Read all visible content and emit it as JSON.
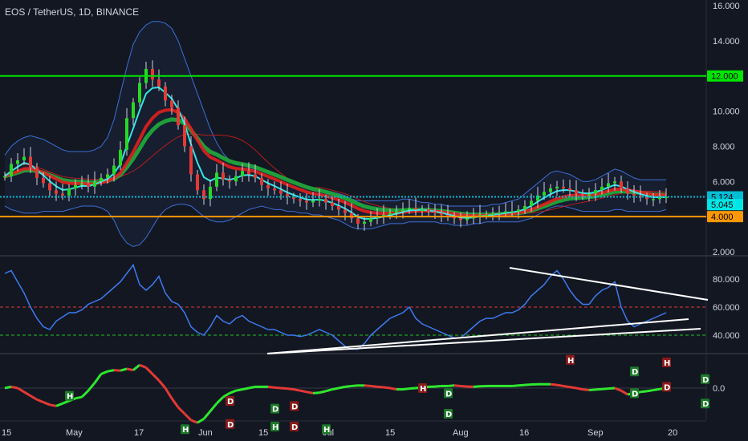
{
  "header": {
    "title": "EOS / TetherUS, 1D, BINANCE"
  },
  "colors": {
    "background": "#131722",
    "grid": "#2a2e39",
    "text": "#d1d4dc",
    "up": "#26d926",
    "down": "#e53935",
    "bb": "#3d6fd6",
    "ema_fast": "#32e6e6",
    "ema_slow": "#e01f1f",
    "ema_green": "#1f9e3a",
    "level_green": "#00e600",
    "level_orange": "#ff9800",
    "level_cyan": "#00bcd4",
    "rsi": "#3d7bf0",
    "rsi_upper": "#e53935",
    "rsi_lower": "#22c322",
    "trend": "#ffffff",
    "osc_up": "#2ee82e",
    "osc_down": "#e53935"
  },
  "chart_data": [
    {
      "type": "candlestick",
      "pair": "EOS / TetherUS",
      "interval": "1D",
      "exchange": "BINANCE",
      "ylim": [
        2,
        16
      ],
      "y_ticks": [
        "2.000",
        "4.000",
        "6.000",
        "8.000",
        "10.000",
        "12.000",
        "14.000",
        "16.000"
      ],
      "x_ticks": [
        "15",
        "May",
        "17",
        "Jun",
        "15",
        "Jul",
        "15",
        "Aug",
        "16",
        "Sep",
        "20"
      ],
      "price_labels": [
        {
          "label": "12.000",
          "value": 12.0,
          "color": "#00e600",
          "text_color": "#000000"
        },
        {
          "label": "5.124",
          "value": 5.124,
          "color": "#00bcd4",
          "text_color": "#000000"
        },
        {
          "label": "5.045",
          "value": 5.045,
          "color": "#00e6e6",
          "text_color": "#000000"
        },
        {
          "label": "4.000",
          "value": 4.0,
          "color": "#ff9800",
          "text_color": "#000000"
        }
      ],
      "horizontal_levels": [
        12.0,
        5.124,
        4.0
      ],
      "close": [
        6.3,
        7.0,
        7.2,
        7.4,
        6.8,
        6.2,
        5.9,
        5.5,
        5.3,
        5.2,
        5.6,
        5.8,
        5.9,
        5.7,
        6.0,
        6.2,
        6.4,
        6.9,
        7.8,
        9.6,
        10.5,
        11.6,
        12.4,
        11.8,
        11.4,
        10.6,
        10.2,
        9.2,
        8.0,
        6.4,
        5.5,
        5.0,
        5.7,
        6.5,
        6.1,
        6.0,
        6.3,
        6.6,
        6.4,
        6.2,
        5.8,
        5.6,
        5.5,
        5.3,
        5.1,
        5.0,
        4.9,
        4.8,
        4.9,
        5.0,
        4.8,
        4.6,
        4.4,
        4.2,
        3.9,
        3.6,
        3.7,
        3.9,
        4.0,
        4.1,
        4.2,
        4.3,
        4.4,
        4.5,
        4.4,
        4.4,
        4.3,
        4.2,
        4.1,
        4.0,
        3.9,
        3.8,
        3.9,
        4.0,
        4.1,
        4.1,
        4.2,
        4.2,
        4.3,
        4.3,
        4.4,
        4.6,
        4.9,
        5.2,
        5.4,
        5.6,
        5.7,
        5.6,
        5.5,
        5.3,
        5.2,
        5.3,
        5.5,
        5.7,
        5.9,
        6.0,
        5.6,
        5.3,
        5.2,
        5.1,
        5.0,
        5.0,
        5.1,
        5.124
      ],
      "bollinger_upper": [
        7.5,
        8.0,
        8.3,
        8.5,
        8.6,
        8.5,
        8.4,
        8.2,
        8.0,
        7.8,
        7.7,
        7.7,
        7.7,
        7.7,
        7.8,
        8.0,
        8.5,
        9.5,
        11.0,
        12.5,
        13.8,
        14.5,
        14.9,
        15.1,
        15.1,
        15.0,
        14.7,
        14.0,
        13.0,
        12.0,
        11.0,
        10.0,
        9.0,
        8.2,
        7.6,
        7.2,
        7.0,
        6.9,
        6.8,
        6.7,
        6.6,
        6.5,
        6.4,
        6.2,
        6.0,
        5.9,
        5.8,
        5.7,
        5.6,
        5.5,
        5.5,
        5.4,
        5.3,
        5.2,
        5.0,
        4.9,
        4.9,
        4.9,
        4.9,
        4.9,
        4.9,
        4.9,
        5.0,
        5.0,
        4.9,
        4.8,
        4.8,
        4.7,
        4.7,
        4.6,
        4.6,
        4.6,
        4.6,
        4.6,
        4.6,
        4.6,
        4.7,
        4.7,
        4.8,
        4.9,
        5.0,
        5.3,
        5.6,
        5.9,
        6.2,
        6.5,
        6.6,
        6.5,
        6.4,
        6.2,
        6.0,
        6.0,
        6.1,
        6.3,
        6.5,
        6.7,
        6.6,
        6.4,
        6.2,
        6.1,
        6.1,
        6.1,
        6.1,
        6.1
      ],
      "bollinger_lower": [
        4.6,
        4.4,
        4.3,
        4.2,
        4.2,
        4.2,
        4.3,
        4.3,
        4.3,
        4.3,
        4.4,
        4.5,
        4.6,
        4.6,
        4.6,
        4.5,
        4.3,
        3.8,
        3.0,
        2.5,
        2.3,
        2.4,
        2.8,
        3.4,
        4.0,
        4.4,
        4.6,
        4.7,
        4.7,
        4.6,
        4.3,
        4.0,
        3.8,
        3.7,
        3.7,
        3.8,
        4.0,
        4.2,
        4.4,
        4.5,
        4.6,
        4.5,
        4.4,
        4.4,
        4.3,
        4.3,
        4.2,
        4.2,
        4.1,
        4.1,
        4.0,
        3.9,
        3.8,
        3.6,
        3.4,
        3.3,
        3.3,
        3.3,
        3.4,
        3.5,
        3.6,
        3.6,
        3.6,
        3.7,
        3.7,
        3.7,
        3.7,
        3.7,
        3.6,
        3.6,
        3.5,
        3.5,
        3.5,
        3.6,
        3.6,
        3.7,
        3.7,
        3.7,
        3.7,
        3.7,
        3.7,
        3.8,
        3.9,
        4.1,
        4.3,
        4.5,
        4.6,
        4.6,
        4.5,
        4.4,
        4.3,
        4.3,
        4.3,
        4.3,
        4.3,
        4.4,
        4.4,
        4.3,
        4.3,
        4.3,
        4.3,
        4.3,
        4.3,
        4.4
      ]
    },
    {
      "type": "line",
      "indicator": "RSI",
      "ylim": [
        20,
        100
      ],
      "y_ticks": [
        "40.000",
        "60.000",
        "80.000"
      ],
      "bands": [
        60,
        40
      ],
      "values": [
        84,
        86,
        78,
        70,
        60,
        52,
        46,
        44,
        50,
        53,
        56,
        56,
        58,
        62,
        64,
        66,
        70,
        74,
        78,
        84,
        90,
        76,
        72,
        76,
        82,
        70,
        64,
        62,
        56,
        46,
        42,
        40,
        46,
        54,
        50,
        48,
        52,
        54,
        50,
        48,
        46,
        44,
        44,
        42,
        40,
        40,
        39,
        40,
        42,
        44,
        42,
        40,
        36,
        32,
        30,
        30,
        34,
        40,
        44,
        48,
        52,
        54,
        56,
        60,
        52,
        48,
        46,
        44,
        42,
        40,
        38,
        38,
        42,
        46,
        50,
        52,
        52,
        54,
        56,
        56,
        58,
        62,
        68,
        72,
        76,
        82,
        86,
        80,
        72,
        66,
        62,
        62,
        68,
        72,
        74,
        78,
        60,
        50,
        46,
        48,
        50,
        52,
        54,
        56
      ],
      "trendlines": [
        {
          "from": [
            87,
            88
          ],
          "to": [
            103,
            65
          ]
        },
        {
          "from": [
            47,
            30
          ],
          "to": [
            103,
            53
          ]
        },
        {
          "from": [
            47,
            30
          ],
          "to": [
            103,
            44
          ]
        }
      ]
    },
    {
      "type": "line",
      "indicator": "oscillator",
      "ylim": [
        -1.4,
        1.2
      ],
      "y_ticks": [
        "0.0"
      ],
      "values": [
        0.0,
        0.05,
        0.0,
        -0.15,
        -0.3,
        -0.45,
        -0.55,
        -0.65,
        -0.7,
        -0.6,
        -0.5,
        -0.4,
        -0.35,
        -0.1,
        0.2,
        0.55,
        0.65,
        0.7,
        0.68,
        0.75,
        0.7,
        0.9,
        0.8,
        0.55,
        0.3,
        0.0,
        -0.4,
        -0.75,
        -1.0,
        -1.25,
        -1.35,
        -1.2,
        -0.9,
        -0.6,
        -0.35,
        -0.2,
        -0.1,
        -0.05,
        0.0,
        0.05,
        0.05,
        0.05,
        0.02,
        0.0,
        -0.02,
        -0.05,
        -0.1,
        -0.15,
        -0.2,
        -0.18,
        -0.12,
        -0.05,
        0.0,
        0.05,
        0.08,
        0.1,
        0.1,
        0.08,
        0.05,
        0.03,
        0.0,
        -0.05,
        -0.05,
        -0.02,
        0.0,
        0.02,
        0.05,
        0.06,
        0.08,
        0.08,
        0.1,
        0.08,
        0.06,
        0.05,
        0.07,
        0.08,
        0.08,
        0.08,
        0.08,
        0.08,
        0.1,
        0.12,
        0.14,
        0.15,
        0.15,
        0.15,
        0.12,
        0.08,
        0.04,
        0.0,
        -0.05,
        -0.08,
        -0.06,
        -0.04,
        -0.02,
        0.0,
        -0.1,
        -0.25,
        -0.2,
        -0.15,
        -0.12,
        -0.08,
        -0.04,
        0.0
      ],
      "markers": [
        {
          "label": "H",
          "index": 10,
          "value": -0.3,
          "kind": "H",
          "color": "#1b7a28"
        },
        {
          "label": "H",
          "index": 28,
          "value": -1.6,
          "kind": "H",
          "color": "#1b7a28"
        },
        {
          "label": "D",
          "index": 35,
          "value": -0.5,
          "kind": "D",
          "color": "#8b1a1a"
        },
        {
          "label": "D",
          "index": 35,
          "value": -1.4,
          "kind": "D",
          "color": "#8b1a1a"
        },
        {
          "label": "D",
          "index": 42,
          "value": -0.8,
          "kind": "D",
          "color": "#1b7a28"
        },
        {
          "label": "H",
          "index": 42,
          "value": -1.5,
          "kind": "H",
          "color": "#1b7a28"
        },
        {
          "label": "D",
          "index": 45,
          "value": -0.7,
          "kind": "D",
          "color": "#8b1a1a"
        },
        {
          "label": "D",
          "index": 45,
          "value": -1.5,
          "kind": "D",
          "color": "#8b1a1a"
        },
        {
          "label": "H",
          "index": 50,
          "value": -1.6,
          "kind": "H",
          "color": "#1b7a28"
        },
        {
          "label": "H",
          "index": 65,
          "value": 0.0,
          "kind": "H",
          "color": "#8b1a1a"
        },
        {
          "label": "D",
          "index": 69,
          "value": -0.2,
          "kind": "D",
          "color": "#1b7a28"
        },
        {
          "label": "D",
          "index": 69,
          "value": -1.0,
          "kind": "D",
          "color": "#1b7a28"
        },
        {
          "label": "H",
          "index": 88,
          "value": 1.1,
          "kind": "H",
          "color": "#8b1a1a"
        },
        {
          "label": "D",
          "index": 98,
          "value": 0.65,
          "kind": "D",
          "color": "#1b7a28"
        },
        {
          "label": "D",
          "index": 98,
          "value": -0.2,
          "kind": "D",
          "color": "#1b7a28"
        },
        {
          "label": "H",
          "index": 103,
          "value": 1.0,
          "kind": "H",
          "color": "#8b1a1a"
        },
        {
          "label": "D",
          "index": 103,
          "value": 0.05,
          "kind": "D",
          "color": "#8b1a1a"
        },
        {
          "label": "D",
          "index": 109,
          "value": 0.35,
          "kind": "D",
          "color": "#1b7a28"
        },
        {
          "label": "D",
          "index": 109,
          "value": -0.6,
          "kind": "D",
          "color": "#1b7a28"
        }
      ]
    }
  ]
}
